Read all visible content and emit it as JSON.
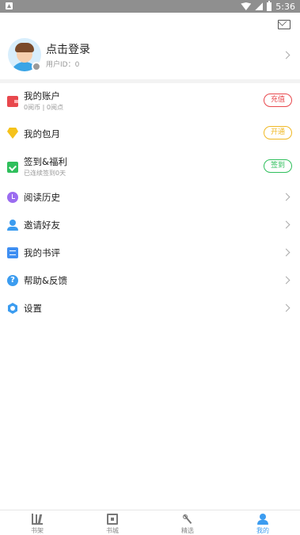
{
  "status_bar": {
    "time": "5:36"
  },
  "profile": {
    "login_text": "点击登录",
    "user_id": "用户ID：0"
  },
  "menu": {
    "account": {
      "title": "我的账户",
      "subtitle": "0阅币 | 0阅点",
      "action": "充值",
      "color": "#e8484d"
    },
    "monthly": {
      "title": "我的包月",
      "action": "开通",
      "color": "#f0b823"
    },
    "checkin": {
      "title": "签到&福利",
      "subtitle": "已连续签到0天",
      "action": "签到",
      "color": "#2fbf5c"
    },
    "history": {
      "title": "阅读历史"
    },
    "invite": {
      "title": "邀请好友"
    },
    "reviews": {
      "title": "我的书评"
    },
    "help": {
      "title": "帮助&反馈",
      "icon_text": "?"
    },
    "settings": {
      "title": "设置"
    }
  },
  "tabs": [
    {
      "label": "书架",
      "icon": "bookshelf-icon"
    },
    {
      "label": "书城",
      "icon": "bookstore-icon"
    },
    {
      "label": "精选",
      "icon": "featured-icon"
    },
    {
      "label": "我的",
      "icon": "profile-icon",
      "active": true
    }
  ],
  "accent_color": "#3b9cf0"
}
